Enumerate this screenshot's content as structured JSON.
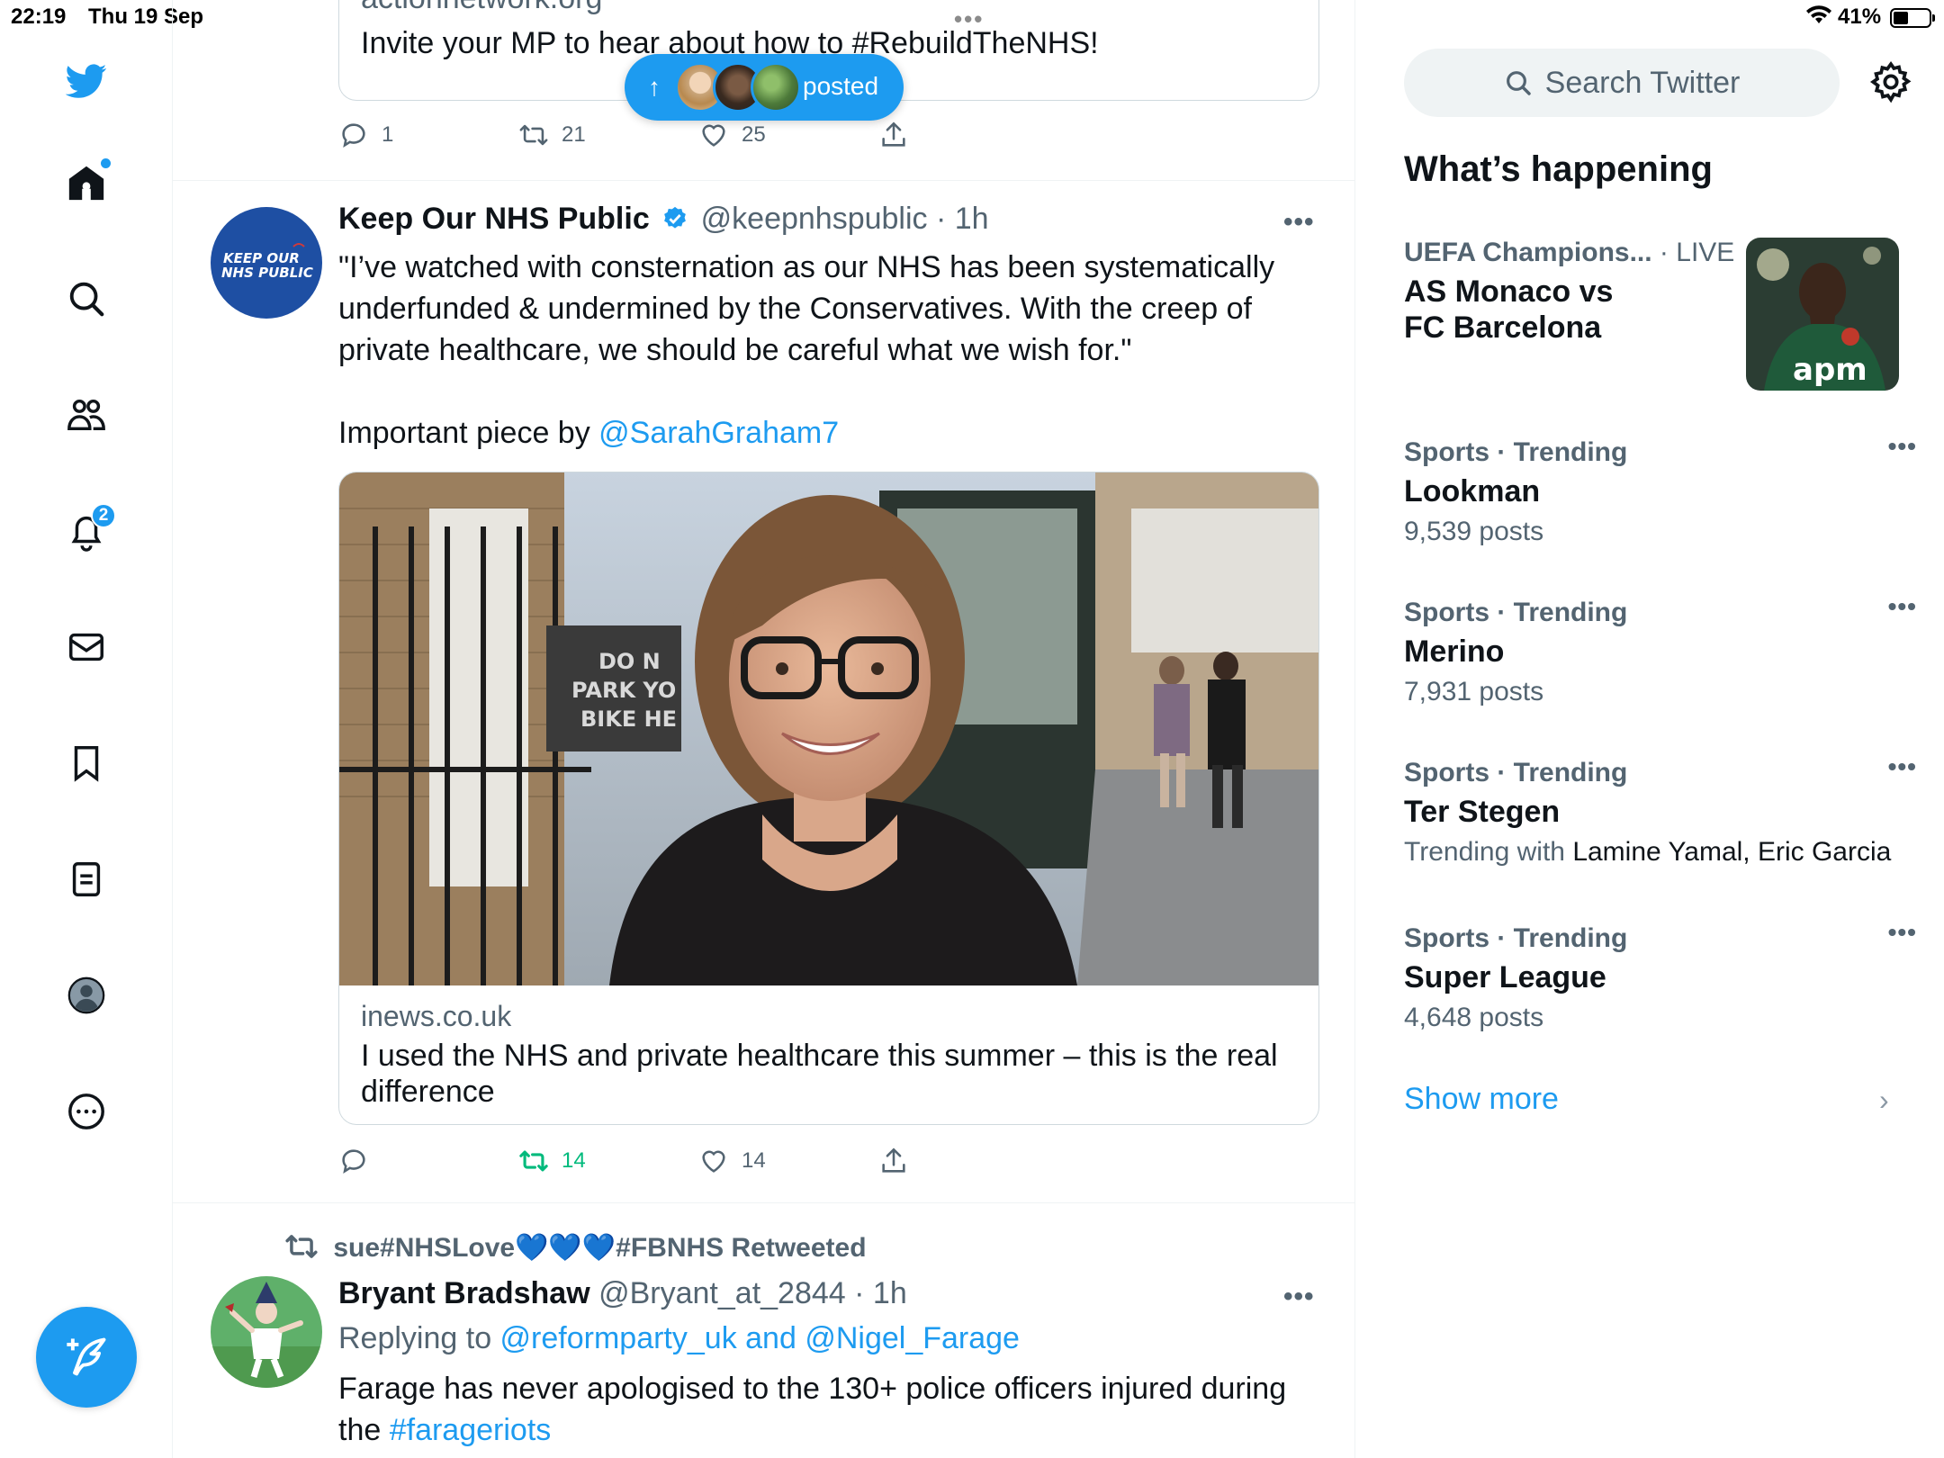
{
  "status_bar": {
    "time": "22:19",
    "date": "Thu 19 Sep",
    "battery": "41%"
  },
  "nav": {
    "notifications_badge": "2",
    "icons": [
      "twitter-logo-icon",
      "home-icon",
      "search-icon",
      "communities-icon",
      "notifications-icon",
      "messages-icon",
      "bookmarks-icon",
      "lists-icon",
      "profile-icon",
      "more-icon",
      "compose-icon"
    ]
  },
  "previous_tweet": {
    "card_domain": "actionnetwork.org",
    "card_title": "Invite your MP to hear about how to #RebuildTheNHS!",
    "replies": "1",
    "retweets": "21",
    "likes": "25"
  },
  "new_posts_pill": {
    "label": "posted"
  },
  "tweet1": {
    "avatar_text_line1": "KEEP OUR",
    "avatar_text_line2": "NHS PUBLIC",
    "name": "Keep Our NHS Public",
    "handle": "@keepnhspublic",
    "time": "· 1h",
    "text_line1": "\"I’ve watched with consternation as our NHS has been systematically",
    "text_line2": "underfunded & undermined by the Conservatives. With the creep of",
    "text_line3": "private healthcare, we should be careful what we wish for.\"",
    "text_line4": "Important piece by ",
    "mention": "@SarahGraham7",
    "sign_text_line1": "DO N",
    "sign_text_line2": "PARK YO",
    "sign_text_line3": "BIKE HE",
    "card_domain": "inews.co.uk",
    "card_title": "I used the NHS and private healthcare this summer – this is the real difference",
    "replies": "",
    "retweets": "14",
    "likes": "14"
  },
  "tweet2": {
    "retweeted_by": "sue#NHSLove💙💙💙#FBNHS Retweeted",
    "name": "Bryant Bradshaw",
    "handle": "@Bryant_at_2844",
    "time": "· 1h",
    "replying_to": "Replying to ",
    "replying_handles": "@reformparty_uk and @Nigel_Farage",
    "text_line1": "Farage has never apologised to the 130+ police officers  injured during",
    "text_line2": "the ",
    "hashtag": "#farageriots"
  },
  "sidebar": {
    "search_placeholder": "Search Twitter",
    "whats_happening": "What’s happening",
    "trends": [
      {
        "meta": "UEFA Champions...",
        "live": " · LIVE",
        "name_line1": "AS Monaco vs",
        "name_line2": "FC Barcelona",
        "image_text": "apm"
      },
      {
        "meta": "Sports · Trending",
        "name": "Lookman",
        "count": "9,539 posts"
      },
      {
        "meta": "Sports · Trending",
        "name": "Merino",
        "count": "7,931 posts"
      },
      {
        "meta": "Sports · Trending",
        "name": "Ter Stegen",
        "trending_with_label": "Trending with ",
        "trending_with": "Lamine Yamal, Eric Garcia"
      },
      {
        "meta": "Sports · Trending",
        "name": "Super League",
        "count": "4,648 posts"
      }
    ],
    "show_more": "Show more"
  },
  "colors": {
    "accent": "#1d9bf0",
    "retweet_active": "#00ba7c",
    "text_primary": "#0f1419",
    "text_secondary": "#536471"
  }
}
